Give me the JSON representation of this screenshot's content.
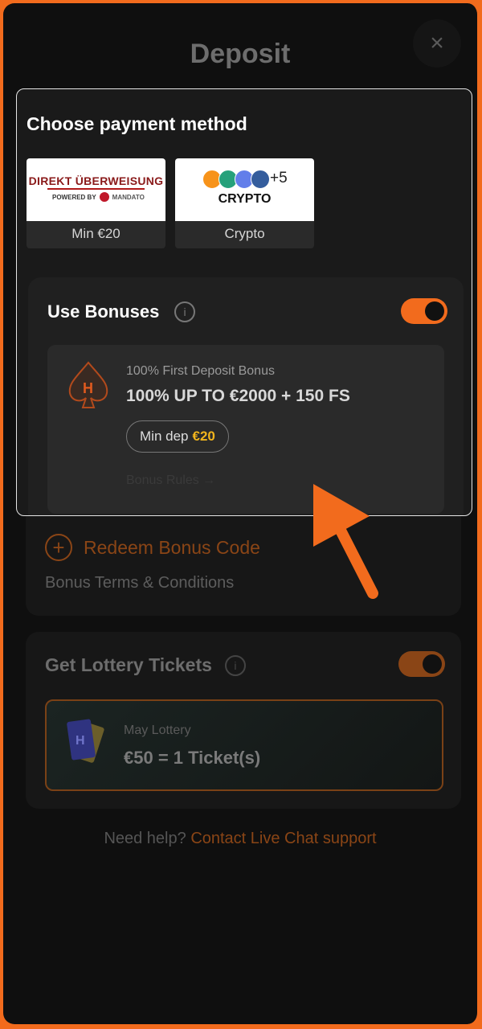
{
  "header": {
    "title": "Deposit",
    "close_symbol": "×"
  },
  "payment": {
    "title": "Choose payment method",
    "methods": [
      {
        "label": "Min €20",
        "logo_text": "DIREKT ÜBERWEISUNG",
        "logo_sub": "POWERED BY",
        "logo_brand": "MANDATO"
      },
      {
        "label": "Crypto",
        "logo_text": "CRYPTO",
        "logo_extra": "+5"
      }
    ]
  },
  "bonuses": {
    "title": "Use Bonuses",
    "info": "i",
    "enabled": true,
    "card": {
      "subtitle": "100% First Deposit Bonus",
      "headline": "100% UP TO €2000 + 150 FS",
      "min_dep_label": "Min dep",
      "min_dep_value": "€20",
      "rules_link": "Bonus Rules →"
    },
    "redeem_label": "Redeem Bonus Code",
    "terms_label": "Bonus Terms & Conditions"
  },
  "lottery": {
    "title": "Get Lottery Tickets",
    "info": "i",
    "enabled": true,
    "card": {
      "subtitle": "May Lottery",
      "headline": "€50 = 1 Ticket(s)"
    }
  },
  "help": {
    "question": "Need help?",
    "link": "Contact Live Chat support"
  },
  "colors": {
    "accent": "#f26b1d",
    "highlight": "#f2b51d",
    "background": "#0f0f0f"
  }
}
